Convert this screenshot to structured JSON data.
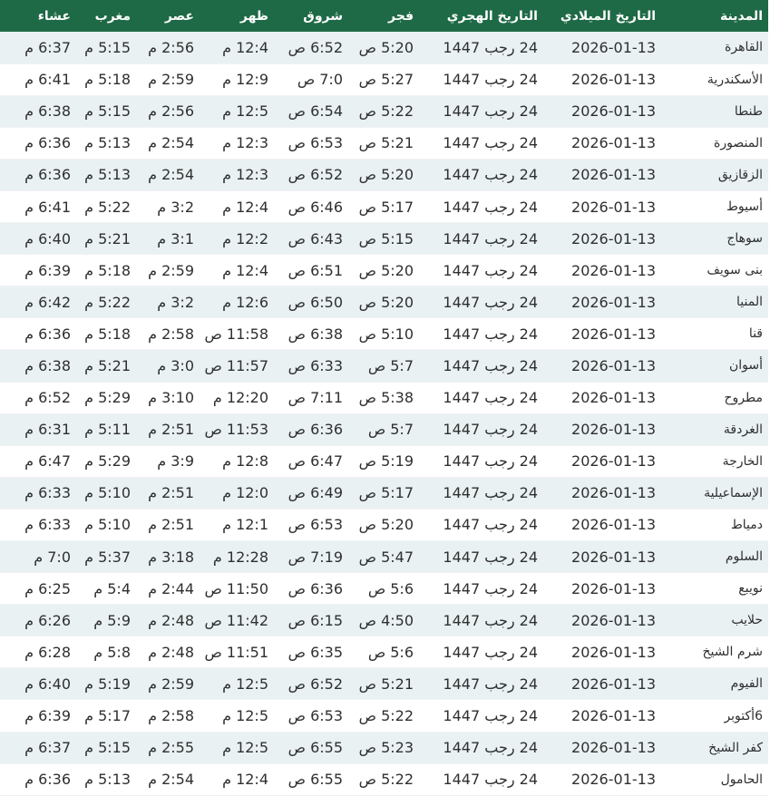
{
  "headers": [
    "المدينة",
    "التاريخ الميلادي",
    "التاريخ الهجري",
    "فجر",
    "شروق",
    "ظهر",
    "عصر",
    "مغرب",
    "عشاء"
  ],
  "rows": [
    [
      "القاهرة",
      "2026-01-13",
      "24 رجب 1447",
      "5:20 ص",
      "6:52 ص",
      "12:4 م",
      "2:56 م",
      "5:15 م",
      "6:37 م"
    ],
    [
      "الأسكندرية",
      "2026-01-13",
      "24 رجب 1447",
      "5:27 ص",
      "7:0 ص",
      "12:9 م",
      "2:59 م",
      "5:18 م",
      "6:41 م"
    ],
    [
      "طنطا",
      "2026-01-13",
      "24 رجب 1447",
      "5:22 ص",
      "6:54 ص",
      "12:5 م",
      "2:56 م",
      "5:15 م",
      "6:38 م"
    ],
    [
      "المنصورة",
      "2026-01-13",
      "24 رجب 1447",
      "5:21 ص",
      "6:53 ص",
      "12:3 م",
      "2:54 م",
      "5:13 م",
      "6:36 م"
    ],
    [
      "الزقازيق",
      "2026-01-13",
      "24 رجب 1447",
      "5:20 ص",
      "6:52 ص",
      "12:3 م",
      "2:54 م",
      "5:13 م",
      "6:36 م"
    ],
    [
      "أسيوط",
      "2026-01-13",
      "24 رجب 1447",
      "5:17 ص",
      "6:46 ص",
      "12:4 م",
      "3:2 م",
      "5:22 م",
      "6:41 م"
    ],
    [
      "سوهاج",
      "2026-01-13",
      "24 رجب 1447",
      "5:15 ص",
      "6:43 ص",
      "12:2 م",
      "3:1 م",
      "5:21 م",
      "6:40 م"
    ],
    [
      "بنى سويف",
      "2026-01-13",
      "24 رجب 1447",
      "5:20 ص",
      "6:51 ص",
      "12:4 م",
      "2:59 م",
      "5:18 م",
      "6:39 م"
    ],
    [
      "المنيا",
      "2026-01-13",
      "24 رجب 1447",
      "5:20 ص",
      "6:50 ص",
      "12:6 م",
      "3:2 م",
      "5:22 م",
      "6:42 م"
    ],
    [
      "قنا",
      "2026-01-13",
      "24 رجب 1447",
      "5:10 ص",
      "6:38 ص",
      "11:58 ص",
      "2:58 م",
      "5:18 م",
      "6:36 م"
    ],
    [
      "أسوان",
      "2026-01-13",
      "24 رجب 1447",
      "5:7 ص",
      "6:33 ص",
      "11:57 ص",
      "3:0 م",
      "5:21 م",
      "6:38 م"
    ],
    [
      "مطروح",
      "2026-01-13",
      "24 رجب 1447",
      "5:38 ص",
      "7:11 ص",
      "12:20 م",
      "3:10 م",
      "5:29 م",
      "6:52 م"
    ],
    [
      "الغردقة",
      "2026-01-13",
      "24 رجب 1447",
      "5:7 ص",
      "6:36 ص",
      "11:53 ص",
      "2:51 م",
      "5:11 م",
      "6:31 م"
    ],
    [
      "الخارجة",
      "2026-01-13",
      "24 رجب 1447",
      "5:19 ص",
      "6:47 ص",
      "12:8 م",
      "3:9 م",
      "5:29 م",
      "6:47 م"
    ],
    [
      "الإسماعيلية",
      "2026-01-13",
      "24 رجب 1447",
      "5:17 ص",
      "6:49 ص",
      "12:0 م",
      "2:51 م",
      "5:10 م",
      "6:33 م"
    ],
    [
      "دمياط",
      "2026-01-13",
      "24 رجب 1447",
      "5:20 ص",
      "6:53 ص",
      "12:1 م",
      "2:51 م",
      "5:10 م",
      "6:33 م"
    ],
    [
      "السلوم",
      "2026-01-13",
      "24 رجب 1447",
      "5:47 ص",
      "7:19 ص",
      "12:28 م",
      "3:18 م",
      "5:37 م",
      "7:0 م"
    ],
    [
      "نويبع",
      "2026-01-13",
      "24 رجب 1447",
      "5:6 ص",
      "6:36 ص",
      "11:50 ص",
      "2:44 م",
      "5:4 م",
      "6:25 م"
    ],
    [
      "حلايب",
      "2026-01-13",
      "24 رجب 1447",
      "4:50 ص",
      "6:15 ص",
      "11:42 ص",
      "2:48 م",
      "5:9 م",
      "6:26 م"
    ],
    [
      "شرم الشيخ",
      "2026-01-13",
      "24 رجب 1447",
      "5:6 ص",
      "6:35 ص",
      "11:51 ص",
      "2:48 م",
      "5:8 م",
      "6:28 م"
    ],
    [
      "الفيوم",
      "2026-01-13",
      "24 رجب 1447",
      "5:21 ص",
      "6:52 ص",
      "12:5 م",
      "2:59 م",
      "5:19 م",
      "6:40 م"
    ],
    [
      "6أكتوبر",
      "2026-01-13",
      "24 رجب 1447",
      "5:22 ص",
      "6:53 ص",
      "12:5 م",
      "2:58 م",
      "5:17 م",
      "6:39 م"
    ],
    [
      "كفر الشيخ",
      "2026-01-13",
      "24 رجب 1447",
      "5:23 ص",
      "6:55 ص",
      "12:5 م",
      "2:55 م",
      "5:15 م",
      "6:37 م"
    ],
    [
      "الحامول",
      "2026-01-13",
      "24 رجب 1447",
      "5:22 ص",
      "6:55 ص",
      "12:4 م",
      "2:54 م",
      "5:13 م",
      "6:36 م"
    ]
  ]
}
